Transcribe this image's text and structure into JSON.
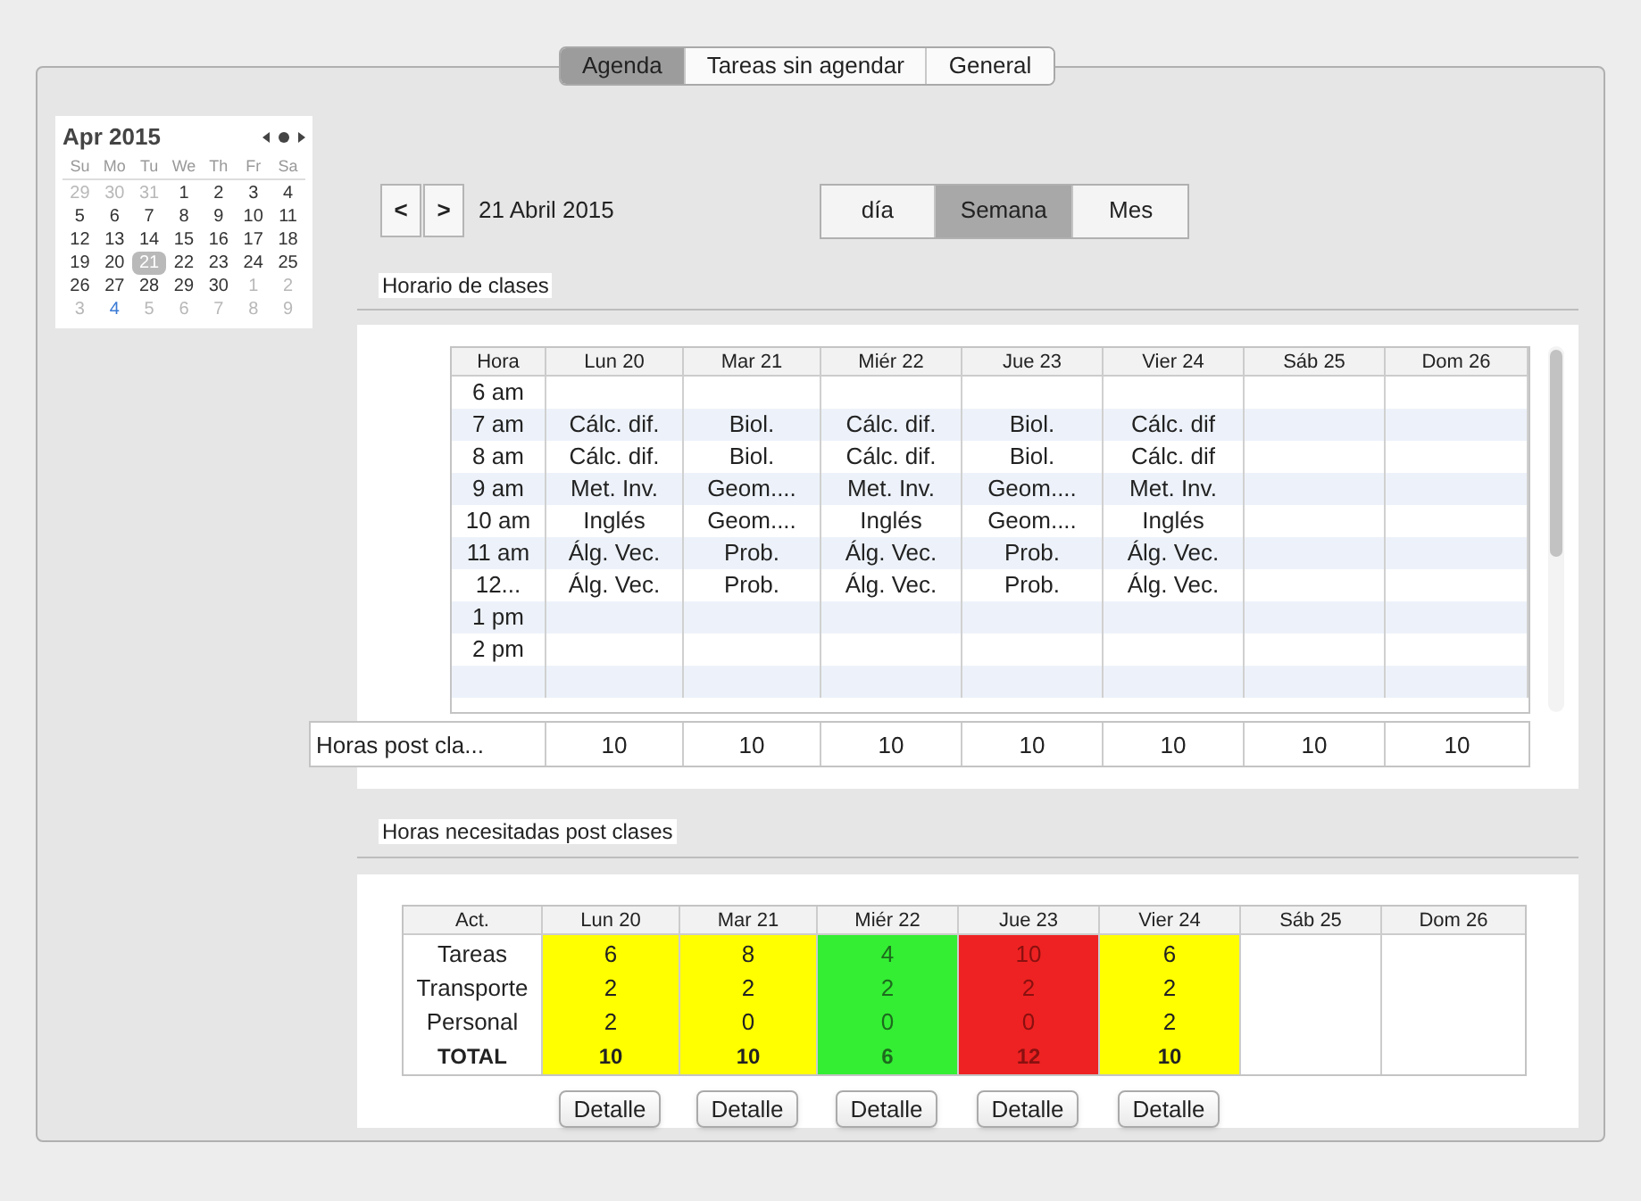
{
  "tabs": [
    {
      "label": "Agenda",
      "selected": true
    },
    {
      "label": "Tareas sin agendar",
      "selected": false
    },
    {
      "label": "General",
      "selected": false
    }
  ],
  "mini_calendar": {
    "title": "Apr 2015",
    "weekdays": [
      "Su",
      "Mo",
      "Tu",
      "We",
      "Th",
      "Fr",
      "Sa"
    ],
    "days": [
      {
        "day": "29",
        "kind": "out"
      },
      {
        "day": "30",
        "kind": "out"
      },
      {
        "day": "31",
        "kind": "out"
      },
      {
        "day": "1",
        "kind": "in"
      },
      {
        "day": "2",
        "kind": "in"
      },
      {
        "day": "3",
        "kind": "in"
      },
      {
        "day": "4",
        "kind": "in"
      },
      {
        "day": "5",
        "kind": "in"
      },
      {
        "day": "6",
        "kind": "in"
      },
      {
        "day": "7",
        "kind": "in"
      },
      {
        "day": "8",
        "kind": "in"
      },
      {
        "day": "9",
        "kind": "in"
      },
      {
        "day": "10",
        "kind": "in"
      },
      {
        "day": "11",
        "kind": "in"
      },
      {
        "day": "12",
        "kind": "in"
      },
      {
        "day": "13",
        "kind": "in"
      },
      {
        "day": "14",
        "kind": "in"
      },
      {
        "day": "15",
        "kind": "in"
      },
      {
        "day": "16",
        "kind": "in"
      },
      {
        "day": "17",
        "kind": "in"
      },
      {
        "day": "18",
        "kind": "in"
      },
      {
        "day": "19",
        "kind": "in"
      },
      {
        "day": "20",
        "kind": "in"
      },
      {
        "day": "21",
        "kind": "selected"
      },
      {
        "day": "22",
        "kind": "in"
      },
      {
        "day": "23",
        "kind": "in"
      },
      {
        "day": "24",
        "kind": "in"
      },
      {
        "day": "25",
        "kind": "in"
      },
      {
        "day": "26",
        "kind": "in"
      },
      {
        "day": "27",
        "kind": "in"
      },
      {
        "day": "28",
        "kind": "in"
      },
      {
        "day": "29",
        "kind": "in"
      },
      {
        "day": "30",
        "kind": "in"
      },
      {
        "day": "1",
        "kind": "out"
      },
      {
        "day": "2",
        "kind": "out"
      },
      {
        "day": "3",
        "kind": "out"
      },
      {
        "day": "4",
        "kind": "marked"
      },
      {
        "day": "5",
        "kind": "out"
      },
      {
        "day": "6",
        "kind": "out"
      },
      {
        "day": "7",
        "kind": "out"
      },
      {
        "day": "8",
        "kind": "out"
      },
      {
        "day": "9",
        "kind": "out"
      }
    ]
  },
  "nav": {
    "prev": "<",
    "next": ">",
    "date": "21 Abril 2015"
  },
  "views": [
    {
      "label": "día",
      "selected": false
    },
    {
      "label": "Semana",
      "selected": true
    },
    {
      "label": "Mes",
      "selected": false
    }
  ],
  "schedule": {
    "title": "Horario de clases",
    "columns": [
      "Hora",
      "Lun 20",
      "Mar 21",
      "Miér 22",
      "Jue 23",
      "Vier 24",
      "Sáb 25",
      "Dom 26"
    ],
    "rows": [
      [
        "6 am"
      ],
      [
        "7 am",
        "Cálc. dif.",
        "Biol.",
        "Cálc. dif.",
        "Biol.",
        "Cálc. dif"
      ],
      [
        "8 am",
        "Cálc. dif.",
        "Biol.",
        "Cálc. dif.",
        "Biol.",
        "Cálc. dif"
      ],
      [
        "9 am",
        "Met. Inv.",
        "Geom....",
        "Met. Inv.",
        "Geom....",
        "Met. Inv."
      ],
      [
        "10 am",
        "Inglés",
        "Geom....",
        "Inglés",
        "Geom....",
        "Inglés"
      ],
      [
        "11 am",
        "Álg. Vec.",
        "Prob.",
        "Álg. Vec.",
        "Prob.",
        "Álg. Vec."
      ],
      [
        "12...",
        "Álg. Vec.",
        "Prob.",
        "Álg. Vec.",
        "Prob.",
        "Álg. Vec."
      ],
      [
        "1 pm"
      ],
      [
        "2 pm"
      ]
    ],
    "post_hours": {
      "label": "Horas post cla...",
      "values": [
        "10",
        "10",
        "10",
        "10",
        "10",
        "10",
        "10"
      ]
    }
  },
  "needed": {
    "title": "Horas necesitadas post clases",
    "header": "Act.",
    "columns": [
      {
        "label": "Lun 20",
        "color": "#ffff00"
      },
      {
        "label": "Mar 21",
        "color": "#ffff00"
      },
      {
        "label": "Miér 22",
        "color": "#33ee33"
      },
      {
        "label": "Jue 23",
        "color": "#ee2222"
      },
      {
        "label": "Vier 24",
        "color": "#ffff00"
      },
      {
        "label": "Sáb 25"
      },
      {
        "label": "Dom 26"
      }
    ],
    "rows": [
      {
        "label": "Tareas",
        "kind": "item",
        "values": [
          "6",
          "8",
          "4",
          "10",
          "6"
        ]
      },
      {
        "label": "Transporte",
        "kind": "item",
        "values": [
          "2",
          "2",
          "2",
          "2",
          "2"
        ]
      },
      {
        "label": "Personal",
        "kind": "item",
        "values": [
          "2",
          "0",
          "0",
          "0",
          "2"
        ]
      },
      {
        "label": "TOTAL",
        "kind": "total",
        "values": [
          "10",
          "10",
          "6",
          "12",
          "10"
        ]
      }
    ],
    "buttons": [
      "Detalle",
      "Detalle",
      "Detalle",
      "Detalle",
      "Detalle"
    ]
  }
}
